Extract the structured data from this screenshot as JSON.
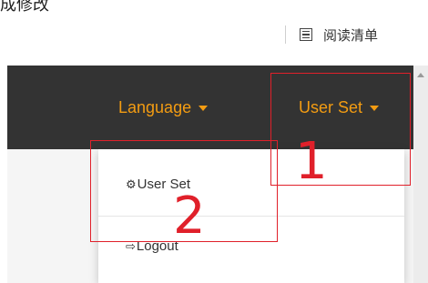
{
  "browser": {
    "top_text_fragment": "成修改",
    "reading_list_label": "阅读清单"
  },
  "navbar": {
    "language_label": "Language",
    "user_set_label": "User Set",
    "accent_color": "#f39c12",
    "background_color": "#333333"
  },
  "dropdown": {
    "items": [
      {
        "icon": "gear-icon",
        "label": "User Set"
      },
      {
        "icon": "sign-out-icon",
        "label": "Logout"
      }
    ]
  },
  "annotations": {
    "box1_number": "1",
    "box2_number": "2",
    "color": "#e0202a"
  }
}
